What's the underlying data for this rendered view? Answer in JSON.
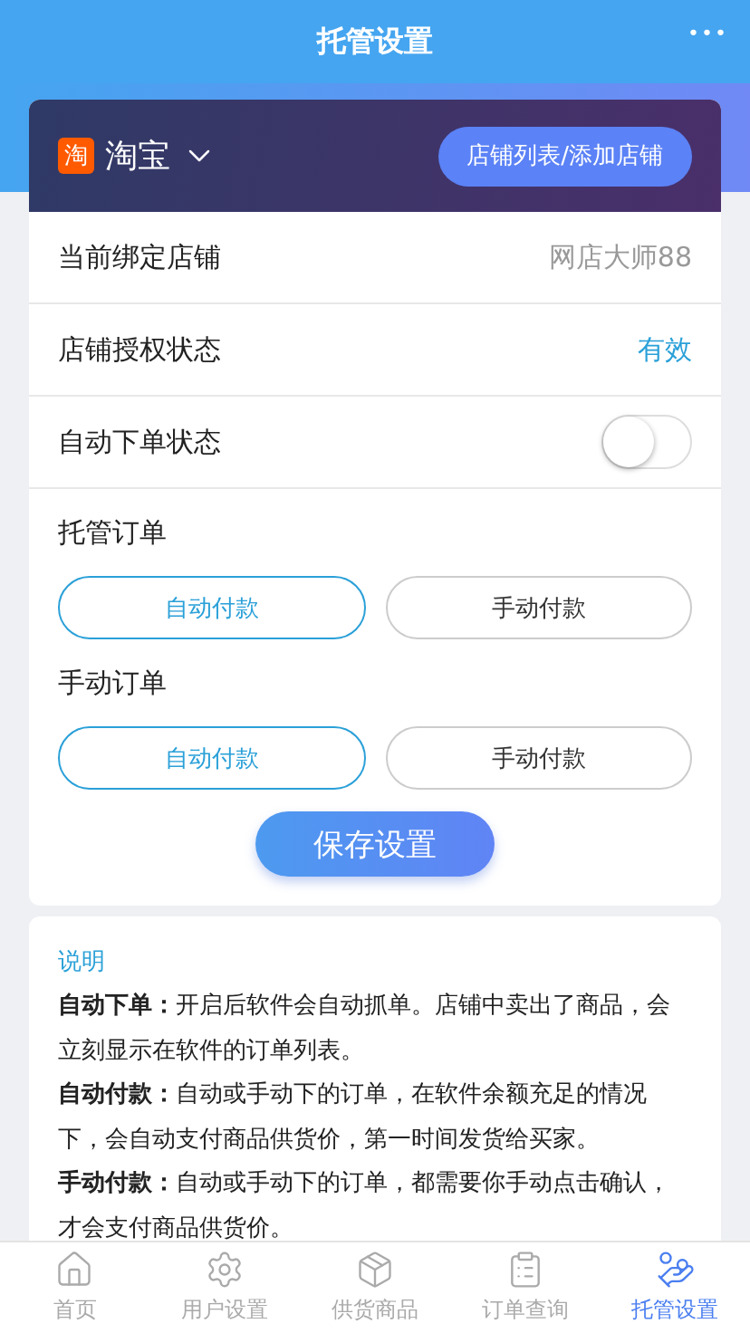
{
  "header": {
    "title": "托管设置",
    "more": "•••"
  },
  "store": {
    "logo": "淘",
    "platform": "淘宝",
    "button": "店铺列表/添加店铺"
  },
  "rows": [
    {
      "kind": "text",
      "label": "当前绑定店铺",
      "value": "网店大师88"
    },
    {
      "kind": "status",
      "label": "店铺授权状态",
      "value": "有效"
    },
    {
      "kind": "toggle",
      "label": "自动下单状态",
      "on": false
    }
  ],
  "groups": [
    {
      "label": "托管订单",
      "options": [
        {
          "label": "自动付款",
          "selected": true
        },
        {
          "label": "手动付款",
          "selected": false
        }
      ]
    },
    {
      "label": "手动订单",
      "options": [
        {
          "label": "自动付款",
          "selected": true
        },
        {
          "label": "手动付款",
          "selected": false
        }
      ]
    }
  ],
  "save_button": "保存设置",
  "notes": {
    "title": "说明",
    "paragraphs": [
      "**自动下单：**开启后软件会自动抓单。店铺中卖出了商品，会立刻显示在软件的订单列表。",
      "**自动付款：**自动或手动下的订单，在软件余额充足的情况下，会自动支付商品供货价，第一时间发货给买家。",
      "**手动付款：**自动或手动下的订单，都需要你手动点击确认，才会支付商品供货价。"
    ]
  },
  "tabs": [
    {
      "label": "首页",
      "selected": false
    },
    {
      "label": "用户设置",
      "selected": false
    },
    {
      "label": "供货商品",
      "selected": false
    },
    {
      "label": "订单查询",
      "selected": false
    },
    {
      "label": "托管设置",
      "selected": true
    }
  ]
}
